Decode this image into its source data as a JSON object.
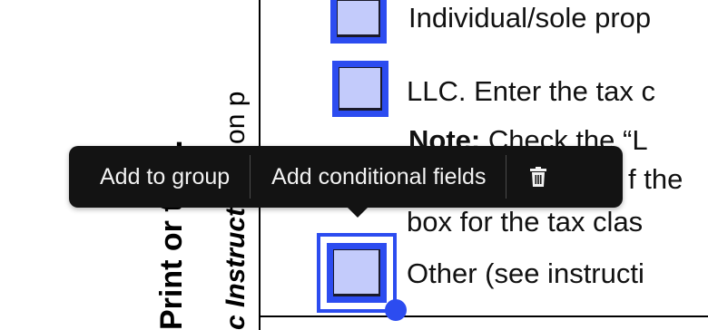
{
  "side_text": {
    "line1_bold_italic": "c Instructions",
    "line1_plain": " on p",
    "line2": "Print or type."
  },
  "form": {
    "option_individual": "Individual/sole prop",
    "option_llc": "LLC. Enter the tax c",
    "note_label": "Note:",
    "note_text": " Check the “L",
    "note_line2_tail": "f the",
    "note_line3": "box for the tax clas",
    "option_other": "Other (see instructi"
  },
  "toolbar": {
    "add_to_group": "Add to group",
    "add_conditional_fields": "Add conditional fields",
    "delete_icon": "trash-icon"
  },
  "colors": {
    "accent": "#2c4cf0",
    "checkbox_fill": "#c3cbfb",
    "toolbar_bg": "#131313"
  }
}
